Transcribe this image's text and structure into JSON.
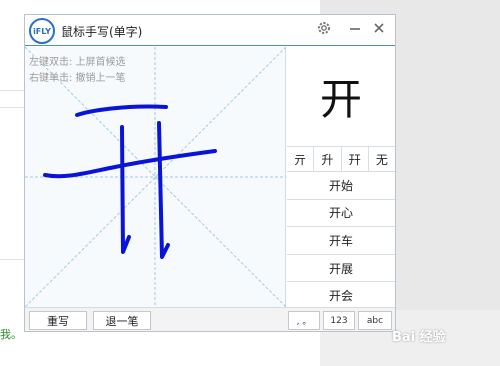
{
  "window": {
    "logo_text": "iFLY",
    "title": "鼠标手写(单字)"
  },
  "canvas": {
    "hint_line1": "左键双击: 上屏首候选",
    "hint_line2": "右键单击: 撤销上一笔",
    "stroke_color": "#0a14d8"
  },
  "preview": {
    "character": "开"
  },
  "candidates": [
    "亓",
    "升",
    "幵",
    "无"
  ],
  "words": [
    "开始",
    "开心",
    "开车",
    "开展",
    "开会"
  ],
  "bottombar": {
    "rewrite_label": "重写",
    "undo_label": "退一笔",
    "punct_label": ", 。",
    "num_label": "123",
    "abc_label": "abc"
  },
  "background": {
    "left_text": "我。"
  },
  "watermark": {
    "text": "Bai 经验"
  },
  "colors": {
    "accent": "#2b6fc7",
    "titlebar_border": "#4d8fd6"
  },
  "icons": {
    "settings": "gear-icon",
    "minimize": "minimize-icon",
    "close": "close-icon"
  }
}
